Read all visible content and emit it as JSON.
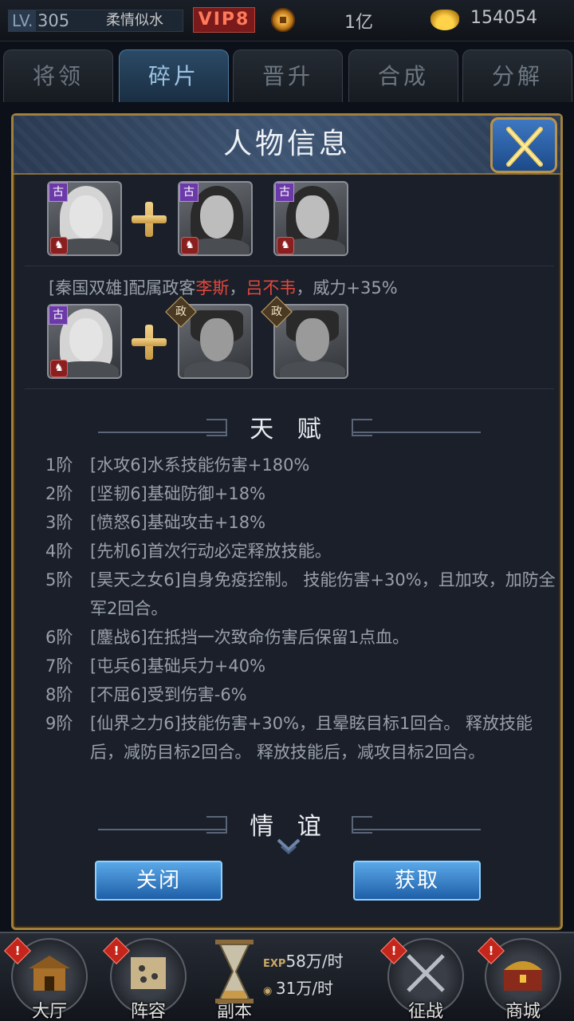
{
  "topbar": {
    "lv_tag": "LV.",
    "level": "305",
    "player_name": "柔情似水",
    "vip": "VIP8",
    "coins": "1亿",
    "gold": "154054"
  },
  "tabs": [
    {
      "label": "将领",
      "active": false
    },
    {
      "label": "碎片",
      "active": true
    },
    {
      "label": "晋升",
      "active": false
    },
    {
      "label": "合成",
      "active": false
    },
    {
      "label": "分解",
      "active": false
    }
  ],
  "dialog": {
    "title": "人物信息",
    "badge_gu": "古",
    "badge_zheng": "政",
    "combo": {
      "prefix": "[秦国双雄]配属政客",
      "name1": "李斯",
      "comma": "，",
      "name2": "吕不韦",
      "suffix": "，威力+35%"
    },
    "talent_title": "天 赋",
    "talents": [
      {
        "level": "1阶",
        "text": "[水攻6]水系技能伤害+180%"
      },
      {
        "level": "2阶",
        "text": "[坚韧6]基础防御+18%"
      },
      {
        "level": "3阶",
        "text": "[愤怒6]基础攻击+18%"
      },
      {
        "level": "4阶",
        "text": "[先机6]首次行动必定释放技能。"
      },
      {
        "level": "5阶",
        "text": "[昊天之女6]自身免疫控制。 技能伤害+30%，且加攻，加防全军2回合。"
      },
      {
        "level": "6阶",
        "text": "[鏖战6]在抵挡一次致命伤害后保留1点血。"
      },
      {
        "level": "7阶",
        "text": "[屯兵6]基础兵力+40%"
      },
      {
        "level": "8阶",
        "text": "[不屈6]受到伤害-6%"
      },
      {
        "level": "9阶",
        "text": "[仙界之力6]技能伤害+30%，且晕眩目标1回合。 释放技能后，减防目标2回合。 释放技能后，减攻目标2回合。"
      }
    ],
    "friendship_title": "情 谊",
    "close_label": "关闭",
    "obtain_label": "获取"
  },
  "bottom_nav": {
    "items": [
      {
        "label": "大厅",
        "alert": "!"
      },
      {
        "label": "阵容",
        "alert": "!"
      },
      {
        "label": "副本",
        "alert": ""
      },
      {
        "label": "征战",
        "alert": "!"
      },
      {
        "label": "商城",
        "alert": "!"
      }
    ],
    "exp_tag": "EXP",
    "exp_rate": "58万/时",
    "coin_rate": "31万/时"
  },
  "colors": {
    "frame_gold": "#a3803a",
    "highlight_red": "#e0483c",
    "button_blue": "#1f5fa8"
  }
}
